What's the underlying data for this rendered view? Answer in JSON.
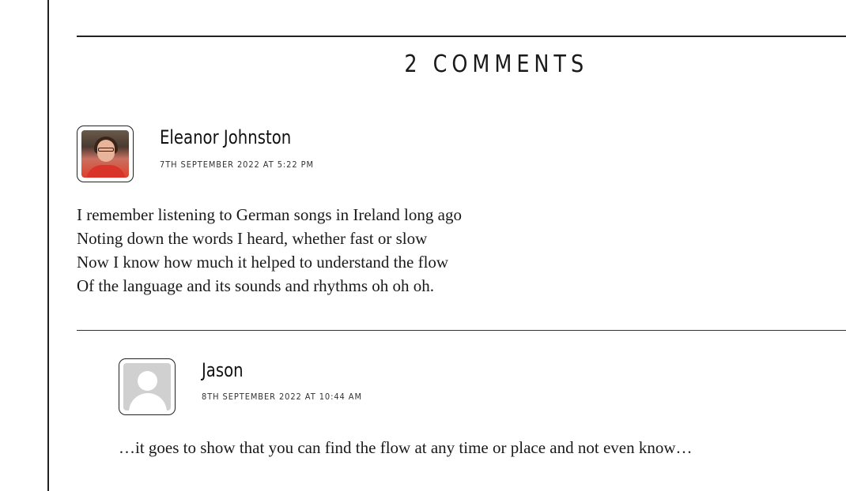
{
  "comments_section": {
    "title": "2 COMMENTS",
    "comments": [
      {
        "author": "Eleanor Johnston",
        "date": "7TH SEPTEMBER 2022 AT 5:22 PM",
        "avatar": "user-photo",
        "lines": [
          "I remember listening to German songs in Ireland long ago",
          "Noting down the words I heard, whether fast or slow",
          "Now I know how much it helped to understand the flow",
          "Of the language and its sounds and rhythms oh oh oh."
        ]
      },
      {
        "author": "Jason",
        "date": "8TH SEPTEMBER 2022 AT 10:44 AM",
        "avatar": "default-avatar-icon",
        "lines": [
          "…it goes to show that you can find the flow at any time or place and not even know…"
        ]
      }
    ]
  }
}
